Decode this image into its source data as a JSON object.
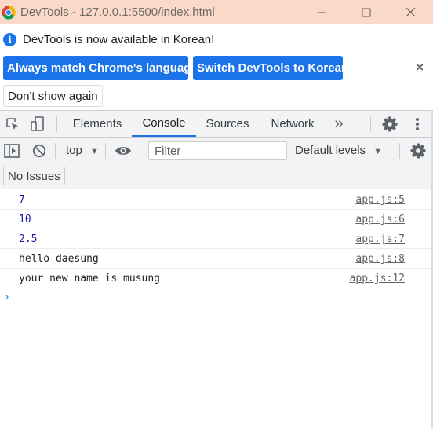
{
  "window": {
    "title": "DevTools - 127.0.0.1:5500/index.html",
    "minimize_icon": "minimize-icon",
    "maximize_icon": "maximize-icon",
    "close_icon": "close-icon"
  },
  "infobar": {
    "message": "DevTools is now available in Korean!",
    "match_language_label": "Always match Chrome's language",
    "switch_language_label": "Switch DevTools to Korean",
    "dont_show_label": "Don't show again",
    "close_glyph": "×"
  },
  "tabs": {
    "items": [
      {
        "label": "Elements"
      },
      {
        "label": "Console"
      },
      {
        "label": "Sources"
      },
      {
        "label": "Network"
      }
    ],
    "more_glyph": "»",
    "active": "Console"
  },
  "console_toolbar": {
    "context": "top",
    "filter_placeholder": "Filter",
    "levels": "Default levels"
  },
  "issues": {
    "label": "No Issues"
  },
  "messages": [
    {
      "text": "7",
      "source": "app.js:5",
      "is_number": true
    },
    {
      "text": "10",
      "source": "app.js:6",
      "is_number": true
    },
    {
      "text": "2.5",
      "source": "app.js:7",
      "is_number": true
    },
    {
      "text": "hello daesung",
      "source": "app.js:8",
      "is_number": false
    },
    {
      "text": "your new name is musung",
      "source": "app.js:12",
      "is_number": false
    }
  ],
  "prompt_glyph": "›",
  "colors": {
    "titlebar": "#fbd9c8",
    "accent": "#1a73e8",
    "number_text": "#1a1aa6",
    "toolbar_bg": "#f1f3f4"
  }
}
